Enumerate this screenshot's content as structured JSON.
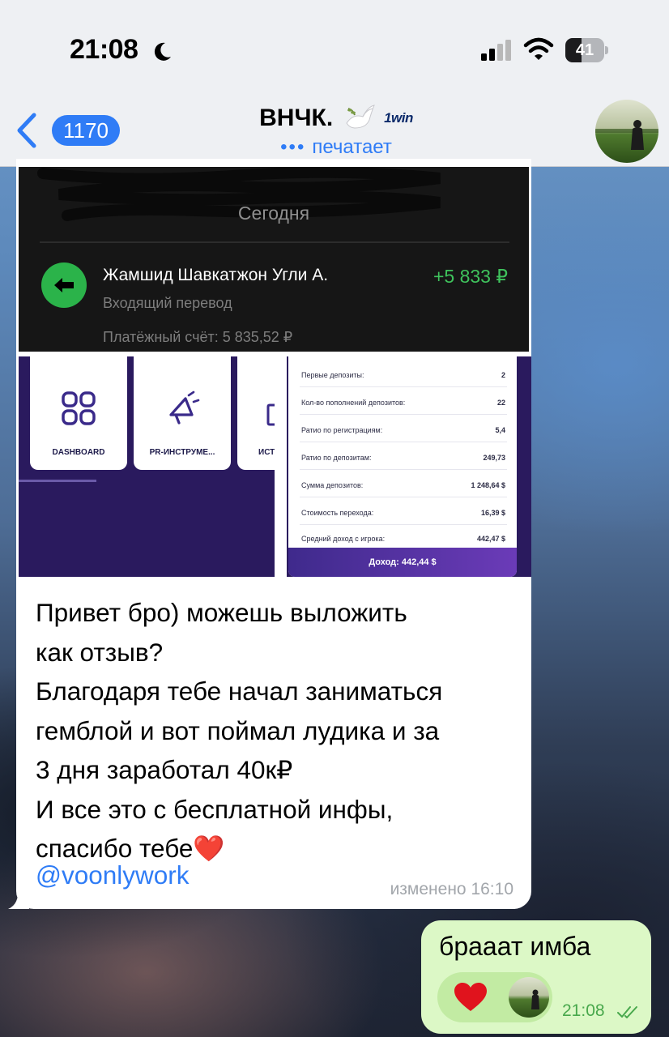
{
  "status_bar": {
    "time": "21:08",
    "battery_level": "41",
    "battery_fraction": 0.41
  },
  "header": {
    "back_count": "1170",
    "chat_title": "ВНЧК.",
    "title_logo": "1win",
    "status": "печатает",
    "typing_indicator": "•••",
    "icons": [
      "moon-icon",
      "signal-icon",
      "wifi-icon",
      "back-chevron-icon",
      "dove-icon"
    ]
  },
  "incoming_message": {
    "bank_screenshot": {
      "section_label": "Сегодня",
      "payer": "Жамшид Шавкатжон Угли А.",
      "amount": "+5 833 ₽",
      "type": "Входящий перевод",
      "balance": "Платёжный счёт: 5 835,52 ₽"
    },
    "dashboard_screenshot": {
      "cards": [
        {
          "label": "DASHBOARD",
          "icon": "grid-icon"
        },
        {
          "label": "PR-ИНСТРУМЕ...",
          "icon": "megaphone-icon"
        },
        {
          "label": "ИСТ",
          "icon": "bracket-icon"
        }
      ]
    },
    "stats_screenshot": {
      "rows": [
        {
          "label": "Первые депозиты:",
          "value": "2"
        },
        {
          "label": "Кол-во пополнений депозитов:",
          "value": "22"
        },
        {
          "label": "Ратио по регистрациям:",
          "value": "5,4"
        },
        {
          "label": "Ратио по депозитам:",
          "value": "249,73"
        },
        {
          "label": "Сумма депозитов:",
          "value": "1 248,64 $"
        },
        {
          "label": "Стоимость перехода:",
          "value": "16,39 $"
        },
        {
          "label": "Средний доход с игрока:",
          "value": "442,47 $"
        }
      ],
      "footer": "Доход: 442,44 $"
    },
    "text": "Привет бро) можешь выложить\nкак отзыв?\nБлагодаря тебе начал заниматься\nгемблой и вот поймал лудика и за\n3 дня заработал 40к₽\nИ все это с бесплатной инфы,\nспасибо тебе❤️",
    "mention": "@voonlywork",
    "meta": "изменено 16:10"
  },
  "outgoing_message": {
    "text": "брааат имба",
    "reaction": "❤️",
    "time": "21:08"
  },
  "colors": {
    "accent": "#2f7cf6",
    "outgoing_bubble": "#dcf8c6",
    "reaction_chip": "#c2eba3",
    "bank_amount": "#3fc25c"
  }
}
